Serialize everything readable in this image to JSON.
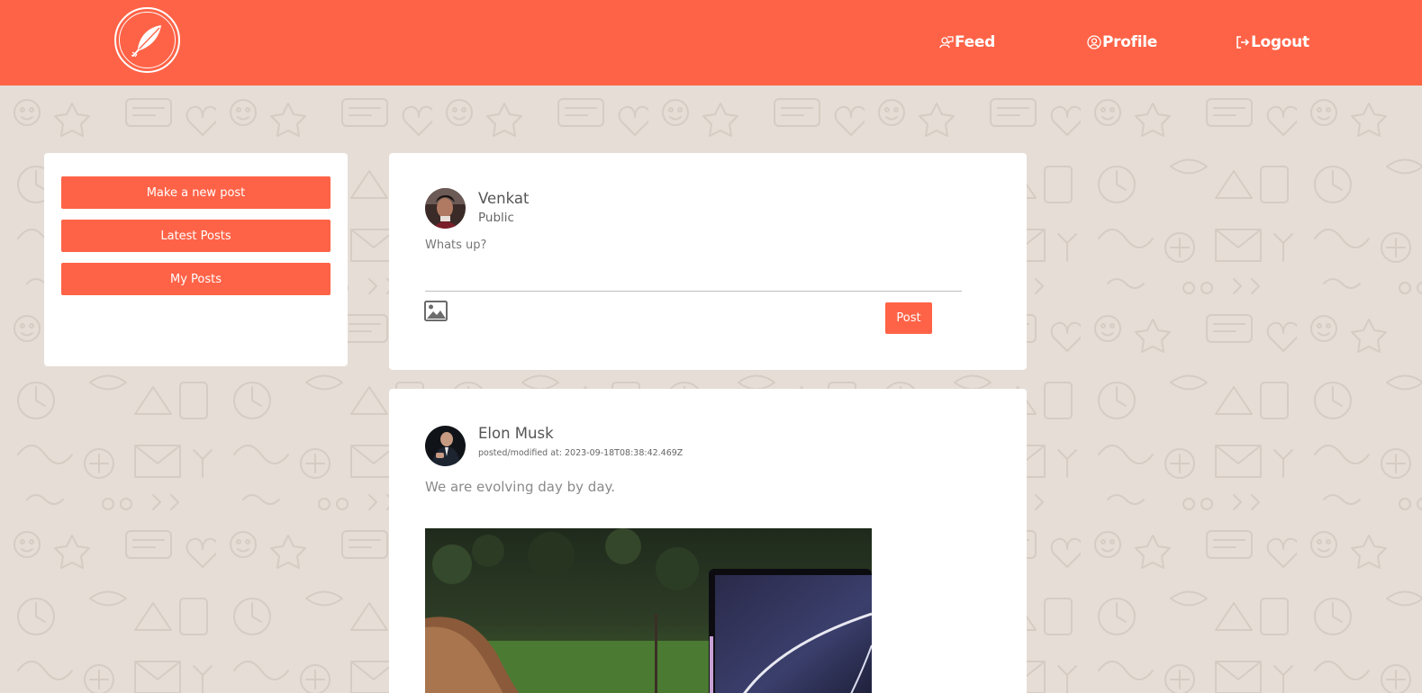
{
  "header": {
    "logo_icon": "feather-icon",
    "nav": [
      {
        "label": "Feed",
        "icon": "feed-icon"
      },
      {
        "label": "Profile",
        "icon": "profile-icon"
      },
      {
        "label": "Logout",
        "icon": "logout-icon"
      }
    ]
  },
  "sidebar": {
    "buttons": [
      "Make a new post",
      "Latest Posts",
      "My Posts"
    ]
  },
  "composer": {
    "user_name": "Venkat",
    "visibility": "Public",
    "text_value": "Whats up?",
    "image_icon": "image-icon",
    "post_label": "Post"
  },
  "feed": {
    "posts": [
      {
        "author": "Elon Musk",
        "timestamp": "posted/modified at: 2023-09-18T08:38:42.469Z",
        "text": "We are evolving day by day."
      }
    ]
  },
  "colors": {
    "accent": "#ff6347",
    "background": "#e5ddd6",
    "card": "#ffffff"
  }
}
